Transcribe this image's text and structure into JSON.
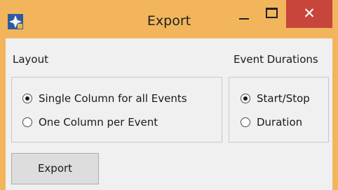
{
  "window": {
    "title": "Export",
    "controls": {
      "minimize": "—",
      "maximize": "□",
      "close": "✕"
    },
    "icon": "app-icon"
  },
  "layout_group": {
    "label": "Layout",
    "options": [
      {
        "label": "Single Column for all Events",
        "selected": true
      },
      {
        "label": "One Column per Event",
        "selected": false
      }
    ]
  },
  "durations_group": {
    "label": "Event Durations",
    "options": [
      {
        "label": "Start/Stop",
        "selected": true
      },
      {
        "label": "Duration",
        "selected": false
      }
    ]
  },
  "actions": {
    "export_label": "Export"
  },
  "colors": {
    "titlebar": "#f2b55c",
    "close": "#c7453b",
    "client": "#f0f0f0"
  }
}
